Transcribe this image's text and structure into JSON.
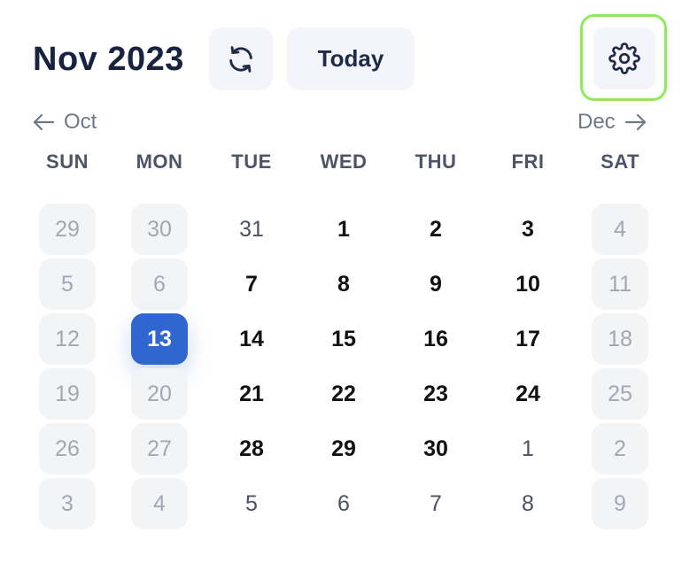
{
  "header": {
    "title": "Nov 2023",
    "today_label": "Today",
    "refresh_icon": "refresh-icon",
    "settings_icon": "gear-icon"
  },
  "nav": {
    "prev_label": "Oct",
    "next_label": "Dec"
  },
  "weekdays": [
    "SUN",
    "MON",
    "TUE",
    "WED",
    "THU",
    "FRI",
    "SAT"
  ],
  "weeks": [
    [
      "29",
      "30",
      "31",
      "1",
      "2",
      "3",
      "4"
    ],
    [
      "5",
      "6",
      "7",
      "8",
      "9",
      "10",
      "11"
    ],
    [
      "12",
      "13",
      "14",
      "15",
      "16",
      "17",
      "18"
    ],
    [
      "19",
      "20",
      "21",
      "22",
      "23",
      "24",
      "25"
    ],
    [
      "26",
      "27",
      "28",
      "29",
      "30",
      "1",
      "2"
    ],
    [
      "3",
      "4",
      "5",
      "6",
      "7",
      "8",
      "9"
    ]
  ],
  "selected_date": "13",
  "colors": {
    "accent": "#2f66d0",
    "focus_outline": "#8eea5c",
    "title": "#17233f",
    "muted": "#a2a7b3"
  }
}
